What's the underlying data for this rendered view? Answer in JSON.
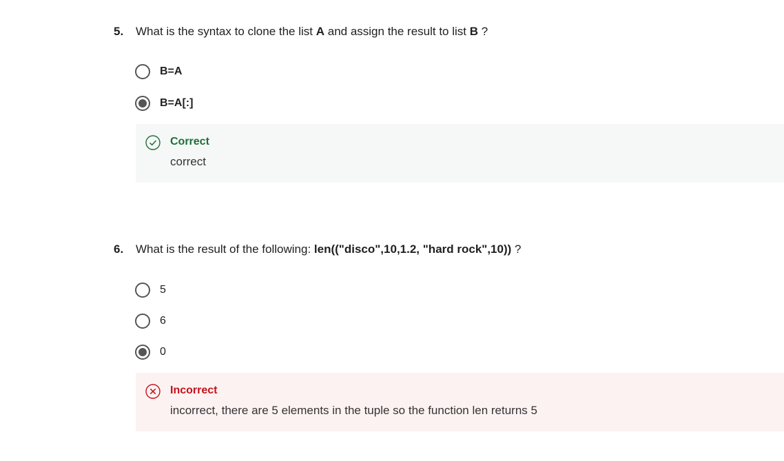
{
  "q5": {
    "number": "5.",
    "text_parts": [
      "What is the syntax to clone the list ",
      "A",
      " and assign the result to list ",
      "B",
      " ?"
    ],
    "options": [
      {
        "label": "B=A",
        "selected": false
      },
      {
        "label": "B=A[:]",
        "selected": true
      }
    ],
    "feedback": {
      "status": "Correct",
      "message": "correct",
      "color": "#1e6e38"
    }
  },
  "q6": {
    "number": "6.",
    "text_parts": [
      "What is the result of the following: ",
      "len((\"disco\",10,1.2, \"hard rock\",10))",
      " ?"
    ],
    "options": [
      {
        "label": "5",
        "selected": false
      },
      {
        "label": "6",
        "selected": false
      },
      {
        "label": "0",
        "selected": true
      }
    ],
    "feedback": {
      "status": "Incorrect",
      "message": "incorrect, there are 5 elements in the tuple so the function len returns 5",
      "color": "#c3121c"
    }
  }
}
